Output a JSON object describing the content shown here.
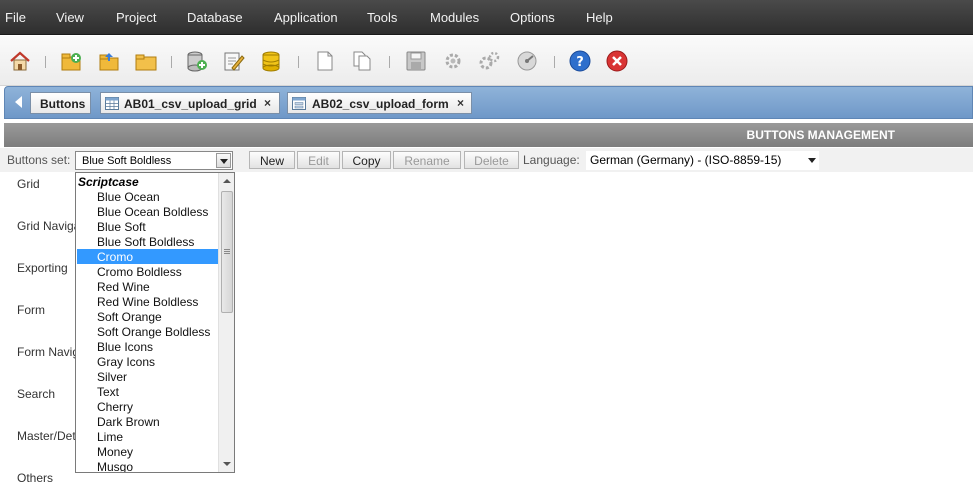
{
  "menu": [
    "File",
    "View",
    "Project",
    "Database",
    "Application",
    "Tools",
    "Modules",
    "Options",
    "Help"
  ],
  "toolbar": {
    "icons": [
      "home-icon",
      "new-project-icon",
      "open-project-icon",
      "folder-icon",
      "new-connection-icon",
      "edit-connection-icon",
      "database-icon",
      "new-document-icon",
      "copy-document-icon",
      "save-icon",
      "generate-icon",
      "generate-all-icon",
      "run-icon",
      "help-icon",
      "close-icon"
    ]
  },
  "tabs": [
    {
      "label": "Buttons",
      "closable": false
    },
    {
      "label": "AB01_csv_upload_grid",
      "closable": true,
      "close": "×"
    },
    {
      "label": "AB02_csv_upload_form",
      "closable": true,
      "close": "×"
    }
  ],
  "header": {
    "title": "BUTTONS MANAGEMENT"
  },
  "controls": {
    "buttons_set_label": "Buttons set:",
    "buttons_set_value": "Blue Soft Boldless",
    "actions": [
      {
        "label": "New",
        "enabled": true
      },
      {
        "label": "Edit",
        "enabled": false
      },
      {
        "label": "Copy",
        "enabled": true
      },
      {
        "label": "Rename",
        "enabled": false
      },
      {
        "label": "Delete",
        "enabled": false
      }
    ],
    "language_label": "Language:",
    "language_value": "German (Germany) - (ISO-8859-15)"
  },
  "left_items": [
    "Grid",
    "Grid Navigation",
    "Exporting",
    "Form",
    "Form Navigation",
    "Search",
    "Master/Detail",
    "Others"
  ],
  "dropdown": {
    "group": "Scriptcase",
    "options": [
      "Blue Ocean",
      "Blue Ocean Boldless",
      "Blue Soft",
      "Blue Soft Boldless",
      "Cromo",
      "Cromo Boldless",
      "Red Wine",
      "Red Wine Boldless",
      "Soft Orange",
      "Soft Orange Boldless",
      "Blue Icons",
      "Gray Icons",
      "Silver",
      "Text",
      "Cherry",
      "Dark Brown",
      "Lime",
      "Money",
      "Musgo"
    ],
    "highlighted": "Cromo"
  }
}
